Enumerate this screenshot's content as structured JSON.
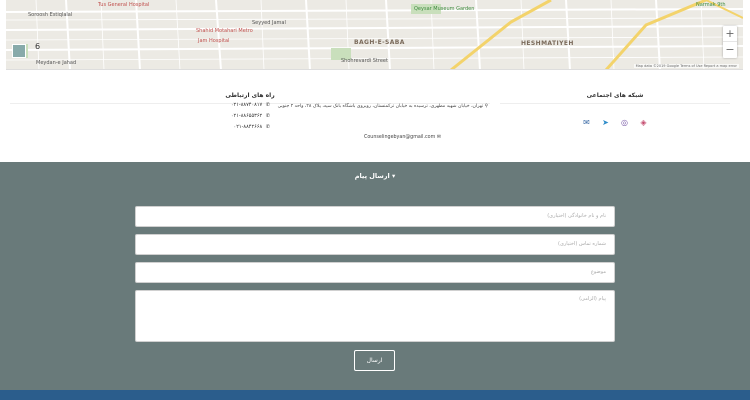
{
  "map": {
    "labels": {
      "tus_hospital": "Tus General Hospital",
      "shahid_motahari_metro": "Shahid Motahari Metro",
      "bahar_hospital": "Jam Hospital",
      "seyyed_jamal": "Seyyed Jamal",
      "sohrevardi": "Sohrevardi",
      "qeysar": "Qeysar Museum Garden",
      "bagh_e_saba": "BAGH-E-SABA",
      "heshmatiyeh": "HESHMATIYEH",
      "shohrevardi_street": "Shohrevardi Street",
      "meydan_jahad": "Meydan-e Jahad",
      "soroosh": "Soroosh Estiqlalal",
      "narmak": "Narmak 9th",
      "jahad": "Jahad"
    },
    "zoom_in": "+",
    "zoom_out": "−",
    "number": "6",
    "attribution": "Map data ©2019 Google   Terms of Use   Report a map error"
  },
  "social": {
    "title": "شبکه های اجتماعی",
    "icons": [
      "mail-icon",
      "telegram-icon",
      "instagram-icon",
      "other-social-icon"
    ]
  },
  "contact": {
    "title": "راه های ارتباطی",
    "phones": [
      "۰۲۱-۸۸۷۴۰۸۱۷",
      "۰۲۱-۸۸۶۵۵۳۶۲",
      "۰۲۱-۸۸۴۲۶۶۸"
    ],
    "address": "تهران، خیابان شهید مطهری، ترسیده به خیابان ترکمنستان، روبروی باشگاه بانک سپه، پلاک ۲۸، واحد ۲ جنوبی",
    "email": "Counselingebyan@gmail.com"
  },
  "form": {
    "title": "ارسال پیام",
    "fields": [
      "نام و نام خانوادگی (اختیاری)",
      "شماره تماس (اختیاری)",
      "موضوع",
      "پیام (الزامی)"
    ],
    "submit": "ارسال"
  },
  "colors": {
    "form_bg": "#697a7a",
    "footer_bar": "#2b5d8c"
  }
}
